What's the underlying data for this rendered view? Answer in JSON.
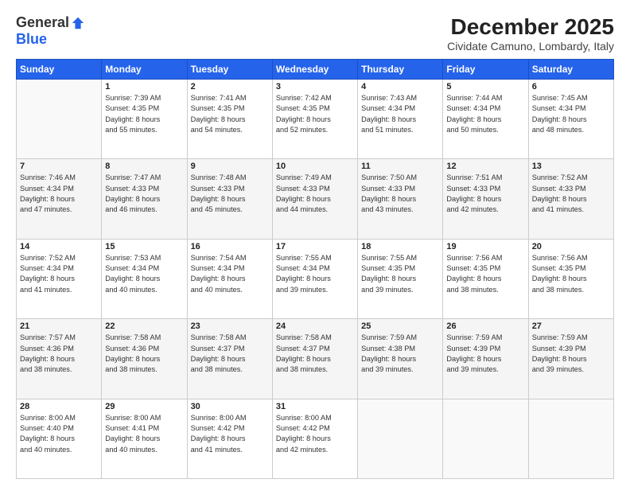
{
  "header": {
    "logo_general": "General",
    "logo_blue": "Blue",
    "month_title": "December 2025",
    "location": "Cividate Camuno, Lombardy, Italy"
  },
  "days_of_week": [
    "Sunday",
    "Monday",
    "Tuesday",
    "Wednesday",
    "Thursday",
    "Friday",
    "Saturday"
  ],
  "weeks": [
    [
      {
        "day": "",
        "info": ""
      },
      {
        "day": "1",
        "info": "Sunrise: 7:39 AM\nSunset: 4:35 PM\nDaylight: 8 hours\nand 55 minutes."
      },
      {
        "day": "2",
        "info": "Sunrise: 7:41 AM\nSunset: 4:35 PM\nDaylight: 8 hours\nand 54 minutes."
      },
      {
        "day": "3",
        "info": "Sunrise: 7:42 AM\nSunset: 4:35 PM\nDaylight: 8 hours\nand 52 minutes."
      },
      {
        "day": "4",
        "info": "Sunrise: 7:43 AM\nSunset: 4:34 PM\nDaylight: 8 hours\nand 51 minutes."
      },
      {
        "day": "5",
        "info": "Sunrise: 7:44 AM\nSunset: 4:34 PM\nDaylight: 8 hours\nand 50 minutes."
      },
      {
        "day": "6",
        "info": "Sunrise: 7:45 AM\nSunset: 4:34 PM\nDaylight: 8 hours\nand 48 minutes."
      }
    ],
    [
      {
        "day": "7",
        "info": "Sunrise: 7:46 AM\nSunset: 4:34 PM\nDaylight: 8 hours\nand 47 minutes."
      },
      {
        "day": "8",
        "info": "Sunrise: 7:47 AM\nSunset: 4:33 PM\nDaylight: 8 hours\nand 46 minutes."
      },
      {
        "day": "9",
        "info": "Sunrise: 7:48 AM\nSunset: 4:33 PM\nDaylight: 8 hours\nand 45 minutes."
      },
      {
        "day": "10",
        "info": "Sunrise: 7:49 AM\nSunset: 4:33 PM\nDaylight: 8 hours\nand 44 minutes."
      },
      {
        "day": "11",
        "info": "Sunrise: 7:50 AM\nSunset: 4:33 PM\nDaylight: 8 hours\nand 43 minutes."
      },
      {
        "day": "12",
        "info": "Sunrise: 7:51 AM\nSunset: 4:33 PM\nDaylight: 8 hours\nand 42 minutes."
      },
      {
        "day": "13",
        "info": "Sunrise: 7:52 AM\nSunset: 4:33 PM\nDaylight: 8 hours\nand 41 minutes."
      }
    ],
    [
      {
        "day": "14",
        "info": "Sunrise: 7:52 AM\nSunset: 4:34 PM\nDaylight: 8 hours\nand 41 minutes."
      },
      {
        "day": "15",
        "info": "Sunrise: 7:53 AM\nSunset: 4:34 PM\nDaylight: 8 hours\nand 40 minutes."
      },
      {
        "day": "16",
        "info": "Sunrise: 7:54 AM\nSunset: 4:34 PM\nDaylight: 8 hours\nand 40 minutes."
      },
      {
        "day": "17",
        "info": "Sunrise: 7:55 AM\nSunset: 4:34 PM\nDaylight: 8 hours\nand 39 minutes."
      },
      {
        "day": "18",
        "info": "Sunrise: 7:55 AM\nSunset: 4:35 PM\nDaylight: 8 hours\nand 39 minutes."
      },
      {
        "day": "19",
        "info": "Sunrise: 7:56 AM\nSunset: 4:35 PM\nDaylight: 8 hours\nand 38 minutes."
      },
      {
        "day": "20",
        "info": "Sunrise: 7:56 AM\nSunset: 4:35 PM\nDaylight: 8 hours\nand 38 minutes."
      }
    ],
    [
      {
        "day": "21",
        "info": "Sunrise: 7:57 AM\nSunset: 4:36 PM\nDaylight: 8 hours\nand 38 minutes."
      },
      {
        "day": "22",
        "info": "Sunrise: 7:58 AM\nSunset: 4:36 PM\nDaylight: 8 hours\nand 38 minutes."
      },
      {
        "day": "23",
        "info": "Sunrise: 7:58 AM\nSunset: 4:37 PM\nDaylight: 8 hours\nand 38 minutes."
      },
      {
        "day": "24",
        "info": "Sunrise: 7:58 AM\nSunset: 4:37 PM\nDaylight: 8 hours\nand 38 minutes."
      },
      {
        "day": "25",
        "info": "Sunrise: 7:59 AM\nSunset: 4:38 PM\nDaylight: 8 hours\nand 39 minutes."
      },
      {
        "day": "26",
        "info": "Sunrise: 7:59 AM\nSunset: 4:39 PM\nDaylight: 8 hours\nand 39 minutes."
      },
      {
        "day": "27",
        "info": "Sunrise: 7:59 AM\nSunset: 4:39 PM\nDaylight: 8 hours\nand 39 minutes."
      }
    ],
    [
      {
        "day": "28",
        "info": "Sunrise: 8:00 AM\nSunset: 4:40 PM\nDaylight: 8 hours\nand 40 minutes."
      },
      {
        "day": "29",
        "info": "Sunrise: 8:00 AM\nSunset: 4:41 PM\nDaylight: 8 hours\nand 40 minutes."
      },
      {
        "day": "30",
        "info": "Sunrise: 8:00 AM\nSunset: 4:42 PM\nDaylight: 8 hours\nand 41 minutes."
      },
      {
        "day": "31",
        "info": "Sunrise: 8:00 AM\nSunset: 4:42 PM\nDaylight: 8 hours\nand 42 minutes."
      },
      {
        "day": "",
        "info": ""
      },
      {
        "day": "",
        "info": ""
      },
      {
        "day": "",
        "info": ""
      }
    ]
  ]
}
